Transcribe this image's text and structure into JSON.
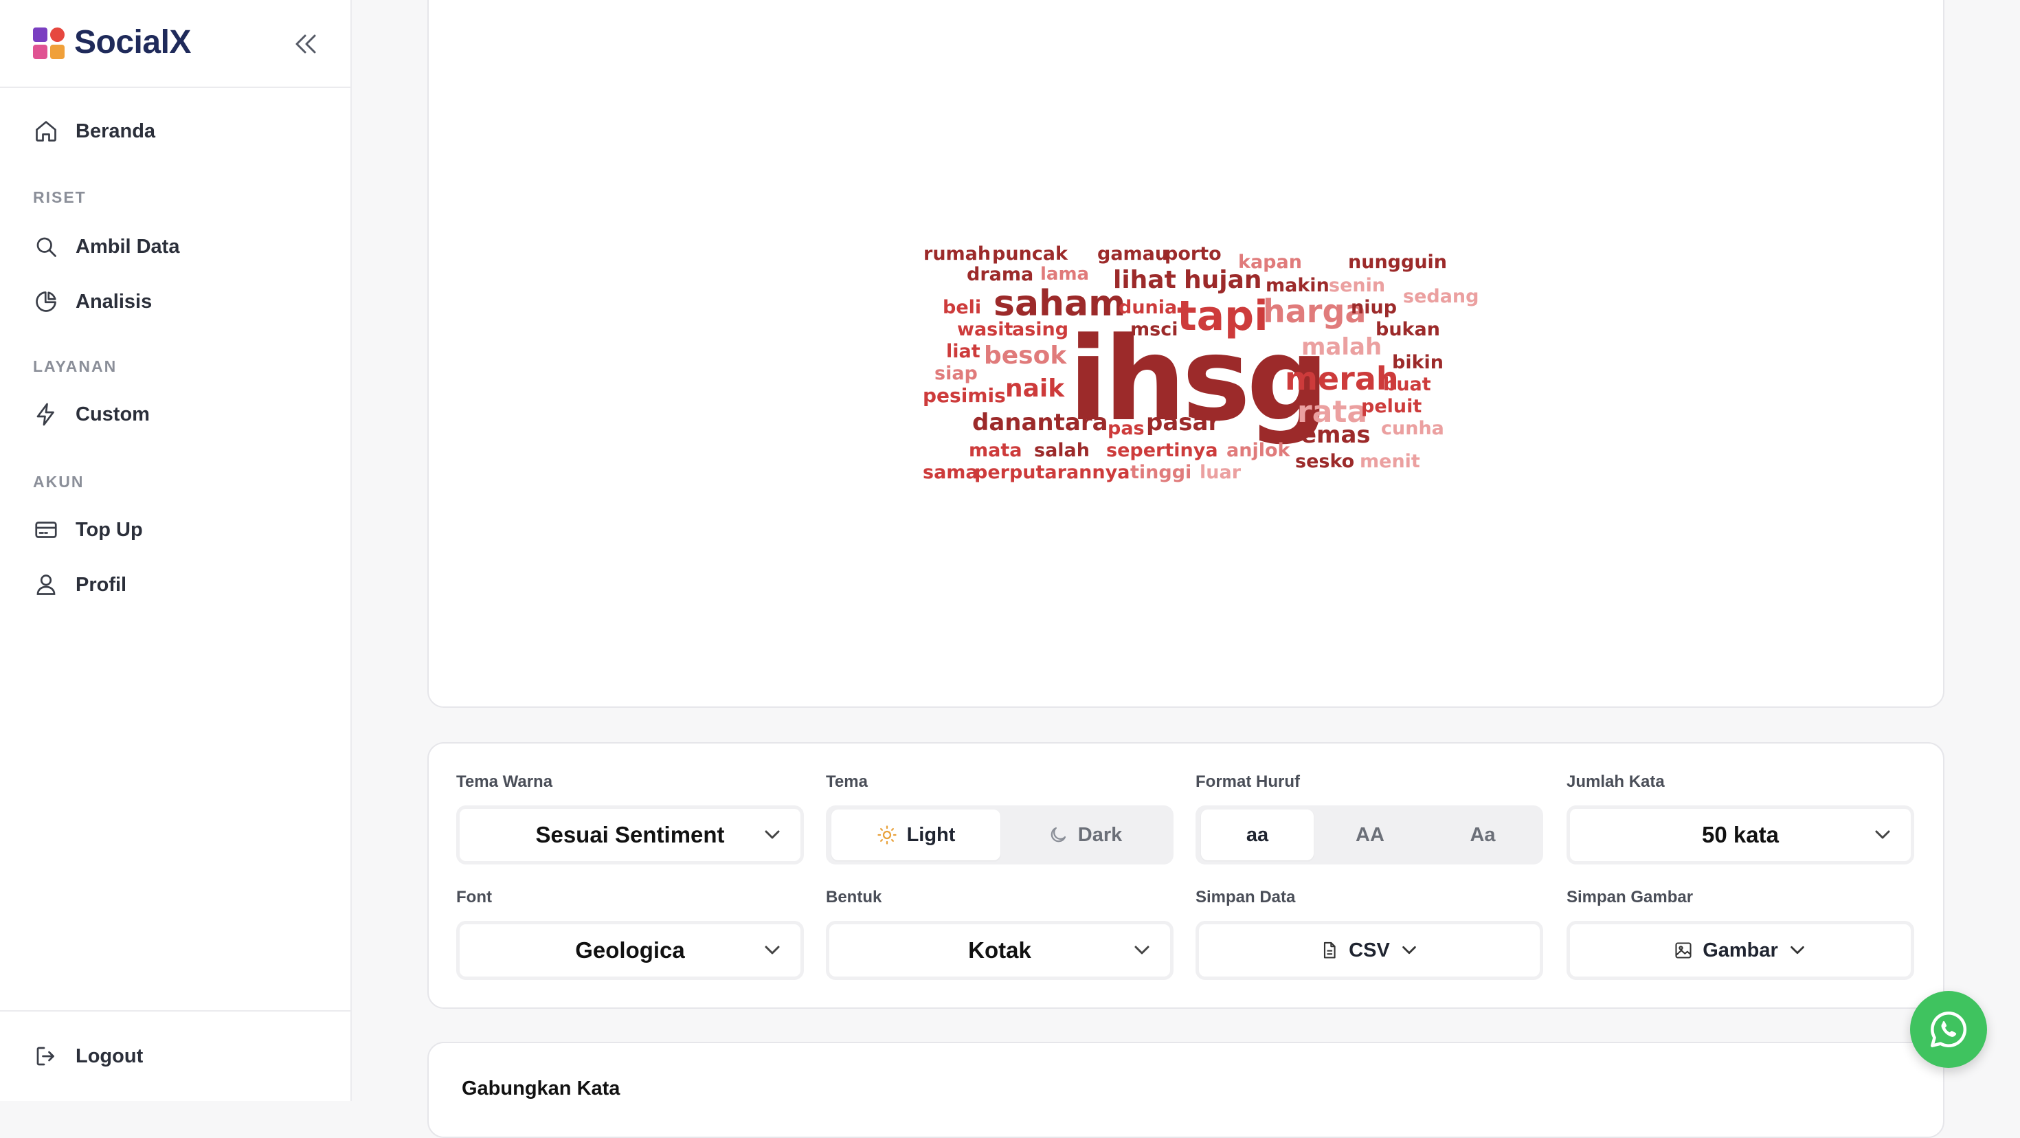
{
  "brand": {
    "name": "SocialX",
    "logo_colors": [
      "#e6473f",
      "#f0a03a",
      "#7a3fc1",
      "#e05393"
    ]
  },
  "sidebar": {
    "home": "Beranda",
    "sections": {
      "riset": "RISET",
      "layanan": "LAYANAN",
      "akun": "AKUN"
    },
    "items": {
      "ambil_data": "Ambil Data",
      "analisis": "Analisis",
      "custom": "Custom",
      "top_up": "Top Up",
      "profil": "Profil"
    },
    "logout": "Logout"
  },
  "wordcloud": {
    "colors": {
      "dark": "#9c2a2a",
      "mid": "#cd3b3b",
      "light": "#e07b7b",
      "pale": "#eba0a0"
    },
    "words": [
      {
        "text": "ihsg",
        "tone": "dark"
      },
      {
        "text": "saham",
        "tone": "dark"
      },
      {
        "text": "tapi",
        "tone": "mid"
      },
      {
        "text": "harga",
        "tone": "light"
      },
      {
        "text": "merah",
        "tone": "mid"
      },
      {
        "text": "rata",
        "tone": "pale"
      },
      {
        "text": "danantara",
        "tone": "dark"
      },
      {
        "text": "pasar",
        "tone": "dark"
      },
      {
        "text": "emas",
        "tone": "dark"
      },
      {
        "text": "besok",
        "tone": "light"
      },
      {
        "text": "naik",
        "tone": "mid"
      },
      {
        "text": "lihat",
        "tone": "dark"
      },
      {
        "text": "hujan",
        "tone": "dark"
      },
      {
        "text": "malah",
        "tone": "pale"
      },
      {
        "text": "rumah",
        "tone": "dark"
      },
      {
        "text": "puncak",
        "tone": "dark"
      },
      {
        "text": "gamau",
        "tone": "dark"
      },
      {
        "text": "porto",
        "tone": "dark"
      },
      {
        "text": "kapan",
        "tone": "light"
      },
      {
        "text": "nungguin",
        "tone": "dark"
      },
      {
        "text": "drama",
        "tone": "dark"
      },
      {
        "text": "lama",
        "tone": "light"
      },
      {
        "text": "makin",
        "tone": "dark"
      },
      {
        "text": "senin",
        "tone": "pale"
      },
      {
        "text": "sedang",
        "tone": "pale"
      },
      {
        "text": "beli",
        "tone": "mid"
      },
      {
        "text": "dunia",
        "tone": "mid"
      },
      {
        "text": "niup",
        "tone": "dark"
      },
      {
        "text": "wasit",
        "tone": "mid"
      },
      {
        "text": "asing",
        "tone": "mid"
      },
      {
        "text": "msci",
        "tone": "dark"
      },
      {
        "text": "bukan",
        "tone": "dark"
      },
      {
        "text": "liat",
        "tone": "mid"
      },
      {
        "text": "bikin",
        "tone": "dark"
      },
      {
        "text": "siap",
        "tone": "light"
      },
      {
        "text": "buat",
        "tone": "mid"
      },
      {
        "text": "pesimis",
        "tone": "mid"
      },
      {
        "text": "peluit",
        "tone": "mid"
      },
      {
        "text": "cunha",
        "tone": "pale"
      },
      {
        "text": "pas",
        "tone": "mid"
      },
      {
        "text": "mata",
        "tone": "mid"
      },
      {
        "text": "salah",
        "tone": "dark"
      },
      {
        "text": "sepertinya",
        "tone": "mid"
      },
      {
        "text": "anjlok",
        "tone": "light"
      },
      {
        "text": "sesko",
        "tone": "dark"
      },
      {
        "text": "menit",
        "tone": "pale"
      },
      {
        "text": "sama",
        "tone": "mid"
      },
      {
        "text": "perputarannya",
        "tone": "mid"
      },
      {
        "text": "tinggi",
        "tone": "light"
      },
      {
        "text": "luar",
        "tone": "pale"
      }
    ]
  },
  "settings": {
    "tema_warna": {
      "label": "Tema Warna",
      "value": "Sesuai Sentiment"
    },
    "tema": {
      "label": "Tema",
      "options": [
        "Light",
        "Dark"
      ],
      "selected": "Light"
    },
    "format_huruf": {
      "label": "Format Huruf",
      "options": [
        "aa",
        "AA",
        "Aa"
      ],
      "selected": "aa"
    },
    "jumlah_kata": {
      "label": "Jumlah Kata",
      "value": "50 kata"
    },
    "font": {
      "label": "Font",
      "value": "Geologica"
    },
    "bentuk": {
      "label": "Bentuk",
      "value": "Kotak"
    },
    "simpan_data": {
      "label": "Simpan Data",
      "value": "CSV"
    },
    "simpan_gambar": {
      "label": "Simpan Gambar",
      "value": "Gambar"
    }
  },
  "gabungkan": {
    "title": "Gabungkan Kata"
  },
  "whatsapp": {
    "color": "#3fc35f"
  }
}
